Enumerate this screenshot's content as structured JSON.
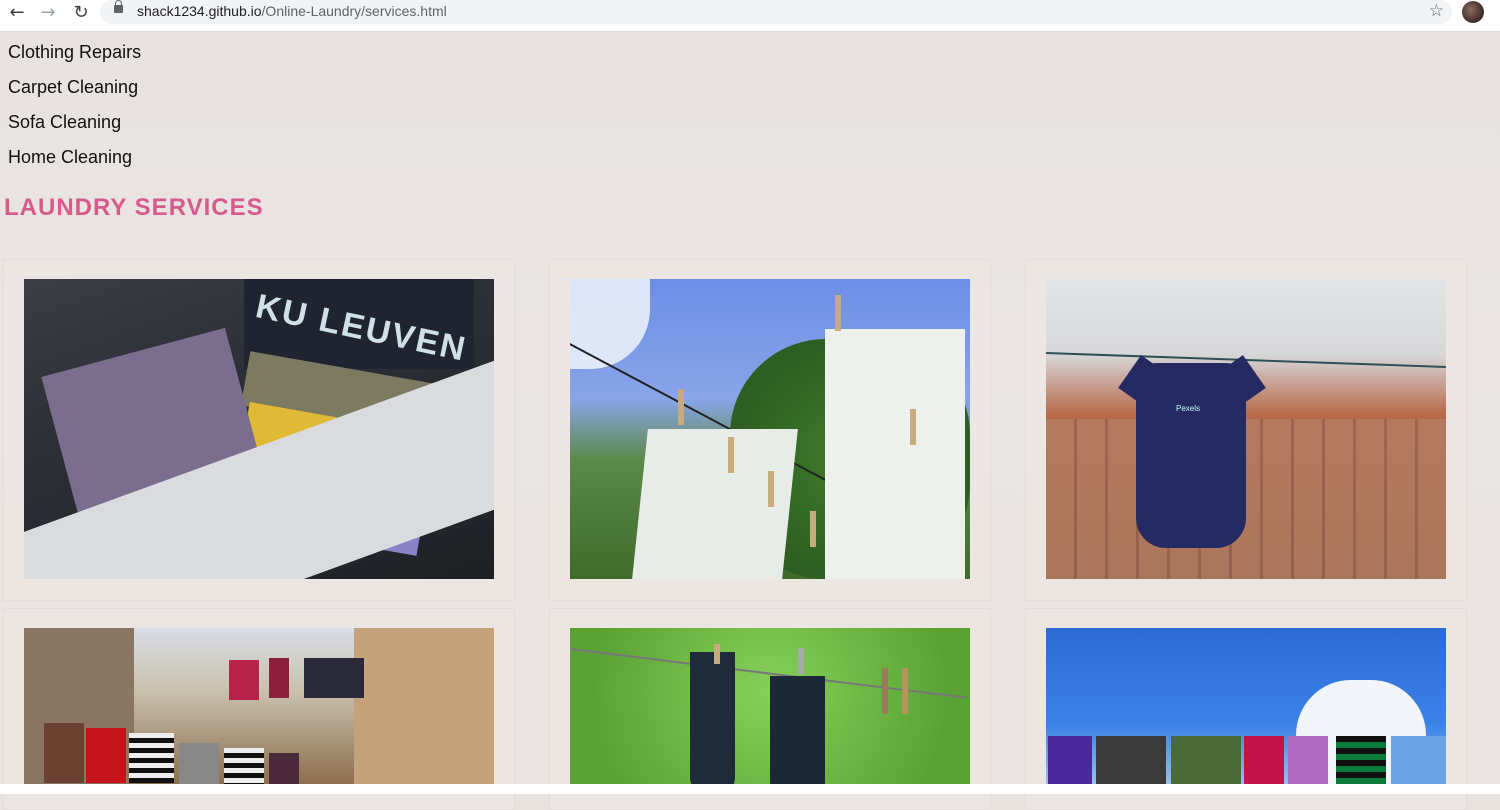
{
  "browser": {
    "url_host": "shack1234.github.io",
    "url_path": "/Online-Laundry/services.html"
  },
  "menu": {
    "items": [
      "Clothing Repairs",
      "Carpet Cleaning",
      "Sofa Cleaning",
      "Home Cleaning"
    ]
  },
  "section": {
    "title": "LAUNDRY SERVICES"
  },
  "images": {
    "img3_logo": "Pexels"
  },
  "colors": {
    "title": "#d65a8c",
    "page_background": "#e8e2df"
  }
}
